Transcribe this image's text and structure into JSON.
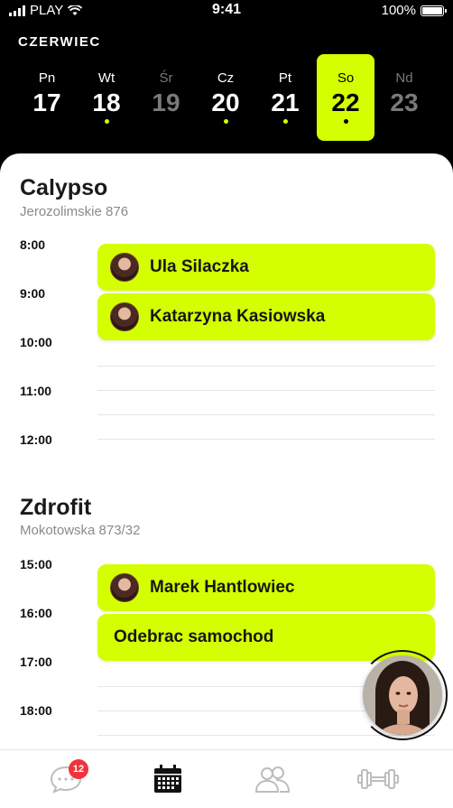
{
  "status_bar": {
    "carrier": "PLAY",
    "time": "9:41",
    "battery": "100%"
  },
  "month": "CZERWIEC",
  "week": [
    {
      "name": "Pn",
      "num": "17",
      "dot": false,
      "state": "normal"
    },
    {
      "name": "Wt",
      "num": "18",
      "dot": true,
      "state": "normal"
    },
    {
      "name": "Śr",
      "num": "19",
      "dot": false,
      "state": "dim"
    },
    {
      "name": "Cz",
      "num": "20",
      "dot": true,
      "state": "normal"
    },
    {
      "name": "Pt",
      "num": "21",
      "dot": true,
      "state": "normal"
    },
    {
      "name": "So",
      "num": "22",
      "dot": true,
      "state": "selected"
    },
    {
      "name": "Nd",
      "num": "23",
      "dot": false,
      "state": "dim"
    }
  ],
  "gyms": [
    {
      "name": "Calypso",
      "address": "Jerozolimskie 876",
      "hours": [
        "8:00",
        "9:00",
        "10:00",
        "11:00",
        "12:00"
      ],
      "events": [
        {
          "title": "Ula Silaczka",
          "avatar": true
        },
        {
          "title": "Katarzyna Kasiowska",
          "avatar": true
        }
      ]
    },
    {
      "name": "Zdrofit",
      "address": "Mokotowska 873/32",
      "hours": [
        "15:00",
        "16:00",
        "17:00",
        "18:00"
      ],
      "events": [
        {
          "title": "Marek Hantlowiec",
          "avatar": true
        },
        {
          "title": "Odebrac samochod",
          "avatar": false
        }
      ]
    }
  ],
  "tabbar": {
    "chat_badge": "12",
    "tabs": [
      "chat-icon",
      "calendar-icon",
      "people-icon",
      "dumbbell-icon"
    ],
    "active": "calendar-icon"
  },
  "colors": {
    "accent": "#d4ff00",
    "badge": "#f0333a",
    "background_dark": "#000000"
  }
}
